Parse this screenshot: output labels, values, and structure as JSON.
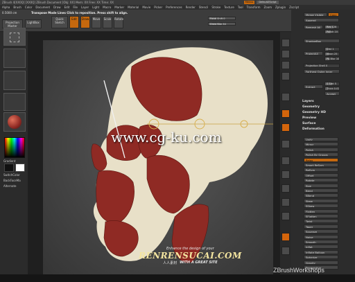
{
  "window": {
    "title": "ZBrush 4[XX0Q] [XX0Q] ZBrush Document   [Obj: XX] Mem: XX Free: XX Time: XX",
    "zbrush_btn": "Menus",
    "script_btn": "DefaultZScript"
  },
  "menus": [
    "Alpha",
    "Brush",
    "Color",
    "Document",
    "Draw",
    "Edit",
    "File",
    "Layer",
    "Light",
    "Macro",
    "Marker",
    "Material",
    "Movie",
    "Picker",
    "Preferences",
    "Render",
    "Stencil",
    "Stroke",
    "Texture",
    "Tool",
    "Transform",
    "Zoom",
    "Zplugin",
    "Zscript"
  ],
  "top_shelf": {
    "coord": "0.5000 cm",
    "status": "Transpose Mode Lines  Click to reposition. Press shift to align.",
    "projection_master": "Projection Master",
    "lightbox": "LightBox",
    "quick_sketch": "Quick Sketch",
    "edit": "Edit",
    "draw": "Draw",
    "move": "Move",
    "scale": "Scale",
    "rotate": "Rotate",
    "focal_shift": "Focal Shift 0",
    "draw_size": "Draw Size 64",
    "focal_level": 0.3,
    "draw_level": 0.45
  },
  "left_shelf": {
    "gradient": "Gradient",
    "switch_color": "SwitchColor",
    "backface": "BackFaceMa",
    "alternate": "Alternate",
    "accent": "#c5680e"
  },
  "viewport": {
    "watermark": "www.cg-ku.com",
    "skull_color": "#e8e0c8",
    "muscle_color": "#8f2a24"
  },
  "right_panel": {
    "merge_visible": "Merge Visible",
    "copy": "Copy",
    "append": "Append",
    "remesh_all": "Remesh All",
    "res": "Res 128",
    "polish": "Polish 10",
    "shadowbox": "ShadowBox",
    "projectall": "ProjectAll",
    "dist": "Dist 1",
    "mean": "Mean 25",
    "pa_blur": "PA Blur 10",
    "projection_shell": "Projection Shell 0",
    "farthest": "Farthest Outer Inner",
    "extract": "Extract",
    "s_smt": "S Smt 5",
    "thick": "Thick 0.02",
    "accept": "Accept",
    "sections": [
      "Layers",
      "Geometry",
      "Geometry HD",
      "Preview",
      "Surface",
      "Deformation"
    ],
    "deform": [
      "Unify",
      "Mirror",
      "Polish",
      "Polish By Groups",
      "Relax",
      "Smart ReSym",
      "ReSym",
      "Offset",
      "Rotate",
      "Size",
      "Bend",
      "SBend",
      "Skew",
      "SSkew",
      "Flatten",
      "SFlatten",
      "Twist",
      "Taper",
      "Squeeze",
      "Noise",
      "Smooth",
      "Inflat",
      "Inflate Balloon",
      "Spherize",
      "Gravity",
      "Perspective"
    ]
  },
  "brand": {
    "corner": "ZBrushWorkshops",
    "rr_tag": "Enhance the design of your",
    "rr_name": "RENRENSUCAI.COM",
    "rr_cn": "人人素材",
    "rr_sub": "WITH A GREAT SITE"
  }
}
